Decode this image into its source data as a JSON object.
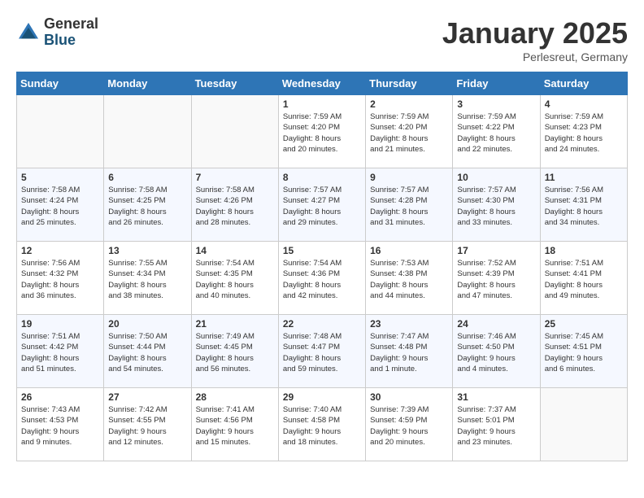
{
  "header": {
    "logo_general": "General",
    "logo_blue": "Blue",
    "month_title": "January 2025",
    "location": "Perlesreut, Germany"
  },
  "days_of_week": [
    "Sunday",
    "Monday",
    "Tuesday",
    "Wednesday",
    "Thursday",
    "Friday",
    "Saturday"
  ],
  "weeks": [
    [
      {
        "day": "",
        "info": ""
      },
      {
        "day": "",
        "info": ""
      },
      {
        "day": "",
        "info": ""
      },
      {
        "day": "1",
        "info": "Sunrise: 7:59 AM\nSunset: 4:20 PM\nDaylight: 8 hours\nand 20 minutes."
      },
      {
        "day": "2",
        "info": "Sunrise: 7:59 AM\nSunset: 4:20 PM\nDaylight: 8 hours\nand 21 minutes."
      },
      {
        "day": "3",
        "info": "Sunrise: 7:59 AM\nSunset: 4:22 PM\nDaylight: 8 hours\nand 22 minutes."
      },
      {
        "day": "4",
        "info": "Sunrise: 7:59 AM\nSunset: 4:23 PM\nDaylight: 8 hours\nand 24 minutes."
      }
    ],
    [
      {
        "day": "5",
        "info": "Sunrise: 7:58 AM\nSunset: 4:24 PM\nDaylight: 8 hours\nand 25 minutes."
      },
      {
        "day": "6",
        "info": "Sunrise: 7:58 AM\nSunset: 4:25 PM\nDaylight: 8 hours\nand 26 minutes."
      },
      {
        "day": "7",
        "info": "Sunrise: 7:58 AM\nSunset: 4:26 PM\nDaylight: 8 hours\nand 28 minutes."
      },
      {
        "day": "8",
        "info": "Sunrise: 7:57 AM\nSunset: 4:27 PM\nDaylight: 8 hours\nand 29 minutes."
      },
      {
        "day": "9",
        "info": "Sunrise: 7:57 AM\nSunset: 4:28 PM\nDaylight: 8 hours\nand 31 minutes."
      },
      {
        "day": "10",
        "info": "Sunrise: 7:57 AM\nSunset: 4:30 PM\nDaylight: 8 hours\nand 33 minutes."
      },
      {
        "day": "11",
        "info": "Sunrise: 7:56 AM\nSunset: 4:31 PM\nDaylight: 8 hours\nand 34 minutes."
      }
    ],
    [
      {
        "day": "12",
        "info": "Sunrise: 7:56 AM\nSunset: 4:32 PM\nDaylight: 8 hours\nand 36 minutes."
      },
      {
        "day": "13",
        "info": "Sunrise: 7:55 AM\nSunset: 4:34 PM\nDaylight: 8 hours\nand 38 minutes."
      },
      {
        "day": "14",
        "info": "Sunrise: 7:54 AM\nSunset: 4:35 PM\nDaylight: 8 hours\nand 40 minutes."
      },
      {
        "day": "15",
        "info": "Sunrise: 7:54 AM\nSunset: 4:36 PM\nDaylight: 8 hours\nand 42 minutes."
      },
      {
        "day": "16",
        "info": "Sunrise: 7:53 AM\nSunset: 4:38 PM\nDaylight: 8 hours\nand 44 minutes."
      },
      {
        "day": "17",
        "info": "Sunrise: 7:52 AM\nSunset: 4:39 PM\nDaylight: 8 hours\nand 47 minutes."
      },
      {
        "day": "18",
        "info": "Sunrise: 7:51 AM\nSunset: 4:41 PM\nDaylight: 8 hours\nand 49 minutes."
      }
    ],
    [
      {
        "day": "19",
        "info": "Sunrise: 7:51 AM\nSunset: 4:42 PM\nDaylight: 8 hours\nand 51 minutes."
      },
      {
        "day": "20",
        "info": "Sunrise: 7:50 AM\nSunset: 4:44 PM\nDaylight: 8 hours\nand 54 minutes."
      },
      {
        "day": "21",
        "info": "Sunrise: 7:49 AM\nSunset: 4:45 PM\nDaylight: 8 hours\nand 56 minutes."
      },
      {
        "day": "22",
        "info": "Sunrise: 7:48 AM\nSunset: 4:47 PM\nDaylight: 8 hours\nand 59 minutes."
      },
      {
        "day": "23",
        "info": "Sunrise: 7:47 AM\nSunset: 4:48 PM\nDaylight: 9 hours\nand 1 minute."
      },
      {
        "day": "24",
        "info": "Sunrise: 7:46 AM\nSunset: 4:50 PM\nDaylight: 9 hours\nand 4 minutes."
      },
      {
        "day": "25",
        "info": "Sunrise: 7:45 AM\nSunset: 4:51 PM\nDaylight: 9 hours\nand 6 minutes."
      }
    ],
    [
      {
        "day": "26",
        "info": "Sunrise: 7:43 AM\nSunset: 4:53 PM\nDaylight: 9 hours\nand 9 minutes."
      },
      {
        "day": "27",
        "info": "Sunrise: 7:42 AM\nSunset: 4:55 PM\nDaylight: 9 hours\nand 12 minutes."
      },
      {
        "day": "28",
        "info": "Sunrise: 7:41 AM\nSunset: 4:56 PM\nDaylight: 9 hours\nand 15 minutes."
      },
      {
        "day": "29",
        "info": "Sunrise: 7:40 AM\nSunset: 4:58 PM\nDaylight: 9 hours\nand 18 minutes."
      },
      {
        "day": "30",
        "info": "Sunrise: 7:39 AM\nSunset: 4:59 PM\nDaylight: 9 hours\nand 20 minutes."
      },
      {
        "day": "31",
        "info": "Sunrise: 7:37 AM\nSunset: 5:01 PM\nDaylight: 9 hours\nand 23 minutes."
      },
      {
        "day": "",
        "info": ""
      }
    ]
  ]
}
